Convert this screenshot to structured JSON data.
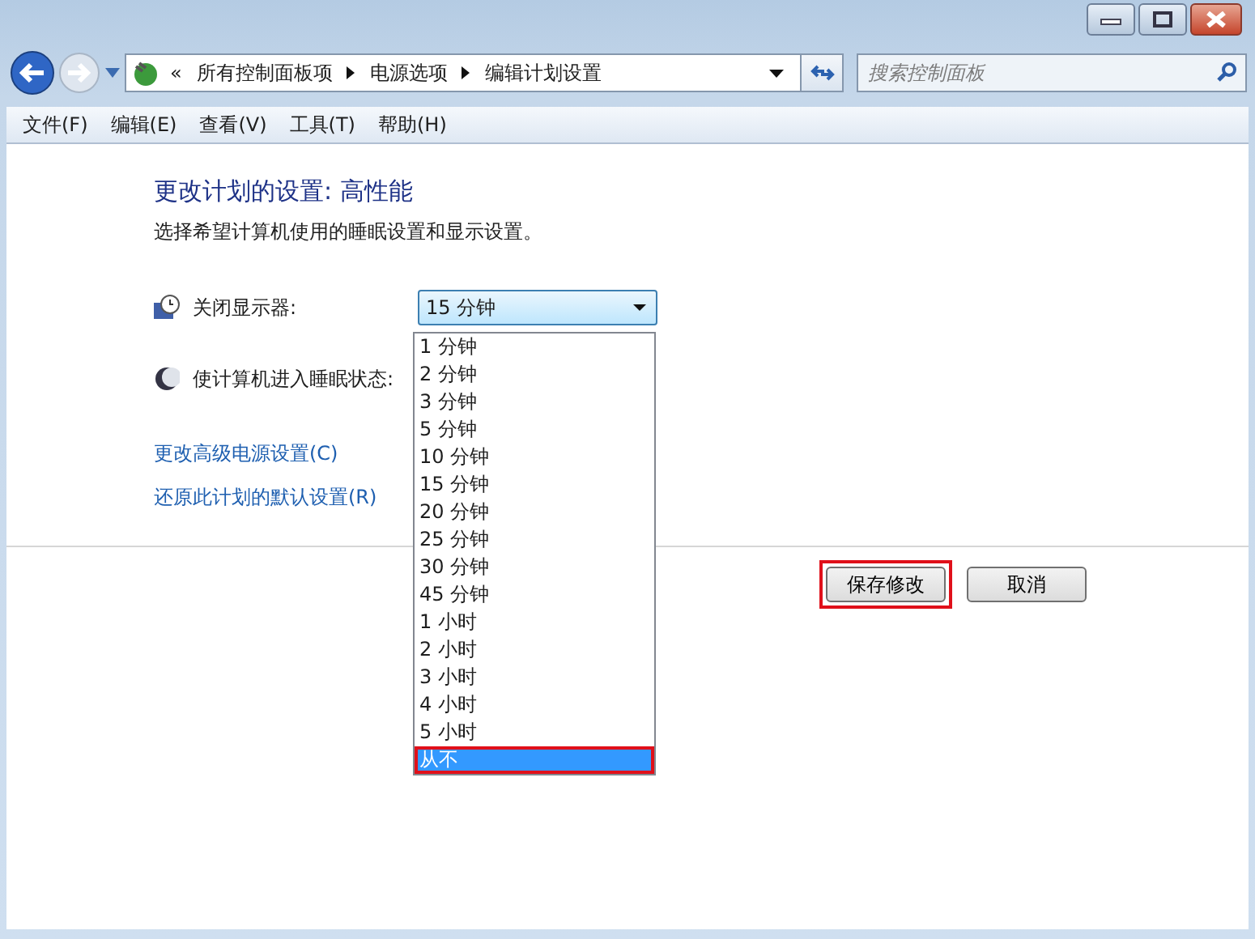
{
  "address_bar": {
    "overflow": "«",
    "crumbs": [
      "所有控制面板项",
      "电源选项",
      "编辑计划设置"
    ]
  },
  "search": {
    "placeholder": "搜索控制面板"
  },
  "menu": [
    "文件(F)",
    "编辑(E)",
    "查看(V)",
    "工具(T)",
    "帮助(H)"
  ],
  "heading": "更改计划的设置: 高性能",
  "description": "选择希望计算机使用的睡眠设置和显示设置。",
  "settings": [
    {
      "kind": "monitor",
      "label": "关闭显示器:",
      "value": "15 分钟"
    },
    {
      "kind": "sleep",
      "label": "使计算机进入睡眠状态:"
    }
  ],
  "links": [
    "更改高级电源设置(C)",
    "还原此计划的默认设置(R)"
  ],
  "dropdown_options": [
    {
      "label": "1 分钟",
      "selected": false
    },
    {
      "label": "2 分钟",
      "selected": false
    },
    {
      "label": "3 分钟",
      "selected": false
    },
    {
      "label": "5 分钟",
      "selected": false
    },
    {
      "label": "10 分钟",
      "selected": false
    },
    {
      "label": "15 分钟",
      "selected": false
    },
    {
      "label": "20 分钟",
      "selected": false
    },
    {
      "label": "25 分钟",
      "selected": false
    },
    {
      "label": "30 分钟",
      "selected": false
    },
    {
      "label": "45 分钟",
      "selected": false
    },
    {
      "label": "1 小时",
      "selected": false
    },
    {
      "label": "2 小时",
      "selected": false
    },
    {
      "label": "3 小时",
      "selected": false
    },
    {
      "label": "4 小时",
      "selected": false
    },
    {
      "label": "5 小时",
      "selected": false
    },
    {
      "label": "从不",
      "selected": true,
      "highlighted": true
    }
  ],
  "buttons": [
    {
      "label": "保存修改",
      "highlighted": true
    },
    {
      "label": "取消",
      "highlighted": false
    }
  ]
}
